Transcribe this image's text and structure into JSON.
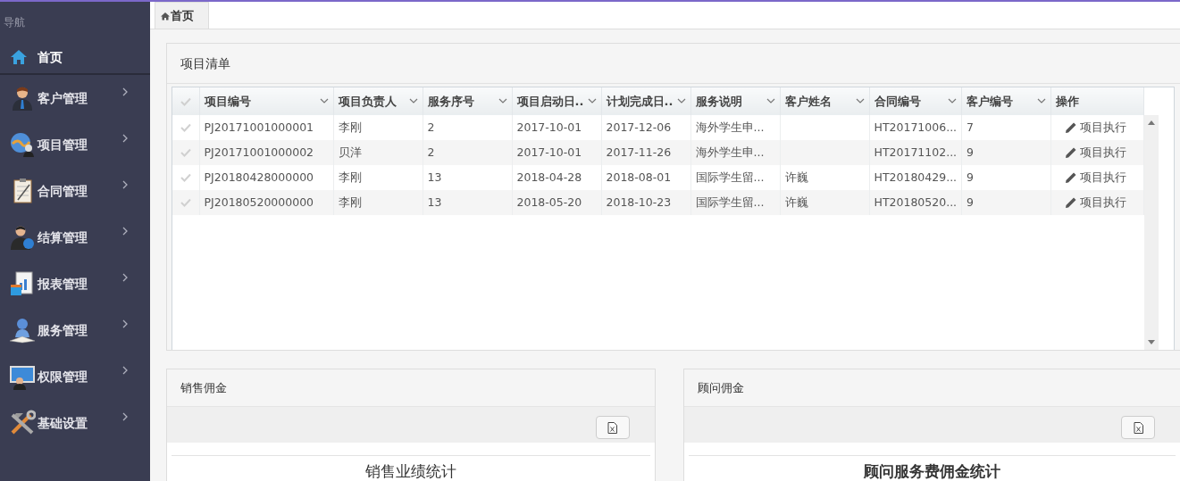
{
  "sidebar": {
    "heading": "导航",
    "items": [
      {
        "label": "首页",
        "kind": "link",
        "selected": true
      },
      {
        "label": "客户管理",
        "kind": "submenu",
        "selected": false
      },
      {
        "label": "项目管理",
        "kind": "submenu",
        "selected": false
      },
      {
        "label": "合同管理",
        "kind": "submenu",
        "selected": false
      },
      {
        "label": "结算管理",
        "kind": "submenu",
        "selected": false
      },
      {
        "label": "报表管理",
        "kind": "submenu",
        "selected": false
      },
      {
        "label": "服务管理",
        "kind": "submenu",
        "selected": false
      },
      {
        "label": "权限管理",
        "kind": "submenu",
        "selected": false
      },
      {
        "label": "基础设置",
        "kind": "submenu",
        "selected": false
      }
    ]
  },
  "tabs": [
    {
      "label": "首页",
      "selected": true
    }
  ],
  "project_panel": {
    "title": "项目清单",
    "table": {
      "select_all_checked": false,
      "columns": [
        {
          "label": "项目编号",
          "sortable": true
        },
        {
          "label": "项目负责人",
          "sortable": true
        },
        {
          "label": "服务序号",
          "sortable": true
        },
        {
          "label": "项目启动日..",
          "sortable": true
        },
        {
          "label": "计划完成日..",
          "sortable": true
        },
        {
          "label": "服务说明",
          "sortable": true
        },
        {
          "label": "客户姓名",
          "sortable": true
        },
        {
          "label": "合同编号",
          "sortable": true
        },
        {
          "label": "客户编号",
          "sortable": true
        },
        {
          "label": "操作",
          "sortable": false
        }
      ],
      "rows": [
        {
          "checked": false,
          "cells": [
            "PJ20171001000001",
            "李刚",
            "2",
            "2017-10-01",
            "2017-12-06",
            "海外学生申...",
            "",
            "HT20171006...",
            "7"
          ],
          "action": "项目执行"
        },
        {
          "checked": false,
          "cells": [
            "PJ20171001000002",
            "贝洋",
            "2",
            "2017-10-01",
            "2017-11-26",
            "海外学生申...",
            "",
            "HT20171102...",
            "9"
          ],
          "action": "项目执行"
        },
        {
          "checked": false,
          "cells": [
            "PJ20180428000000",
            "李刚",
            "13",
            "2018-04-28",
            "2018-08-01",
            "国际学生留...",
            "许巍",
            "HT20180429...",
            "9"
          ],
          "action": "项目执行"
        },
        {
          "checked": false,
          "cells": [
            "PJ20180520000000",
            "李刚",
            "13",
            "2018-05-20",
            "2018-10-23",
            "国际学生留...",
            "许巍",
            "HT20180520...",
            "9"
          ],
          "action": "项目执行"
        }
      ]
    }
  },
  "commission_panels": [
    {
      "title": "销售佣金",
      "report_title": "销售业绩统计",
      "emphasized": false
    },
    {
      "title": "顾问佣金",
      "report_title": "顾问服务费佣金统计",
      "emphasized": true
    }
  ]
}
